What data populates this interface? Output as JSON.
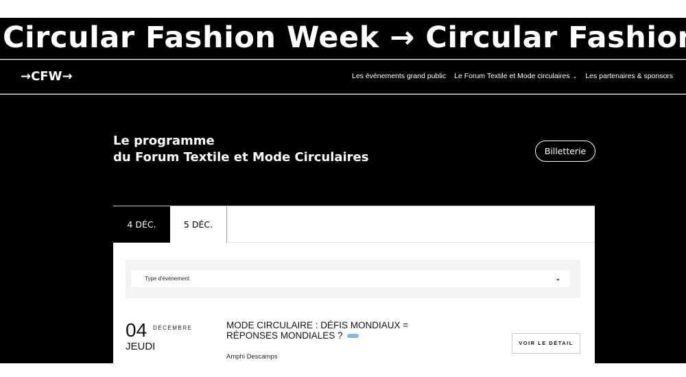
{
  "marquee": {
    "text": "Circular Fashion Week → Circular Fashion Week"
  },
  "nav": {
    "logo": "→CFW→",
    "links": [
      {
        "label": "Les événements grand public"
      },
      {
        "label": "Le Forum Textile et Mode circulaires",
        "chevron": "⌄"
      },
      {
        "label": "Les partenaires & sponsors"
      }
    ]
  },
  "hero": {
    "title_line1": "Le programme",
    "title_line2": "du Forum Textile et Mode Circulaires",
    "ticket_label": "Billetterie"
  },
  "program": {
    "tabs": [
      {
        "label": "4 DÉC.",
        "active": true
      },
      {
        "label": "5 DÉC.",
        "active": false
      }
    ],
    "filter": {
      "label": "Type d'événement",
      "chevron": "⌄"
    },
    "event": {
      "day_number": "04",
      "month": "DÉCEMBRE",
      "weekday": "JEUDI",
      "title": "MODE CIRCULAIRE : DÉFIS MONDIAUX = RÉPONSES MONDIALES ?",
      "tag_color": "#8ab4e0",
      "venue": "Amphi Descamps",
      "detail_label": "VOIR LE DÉTAIL"
    }
  }
}
